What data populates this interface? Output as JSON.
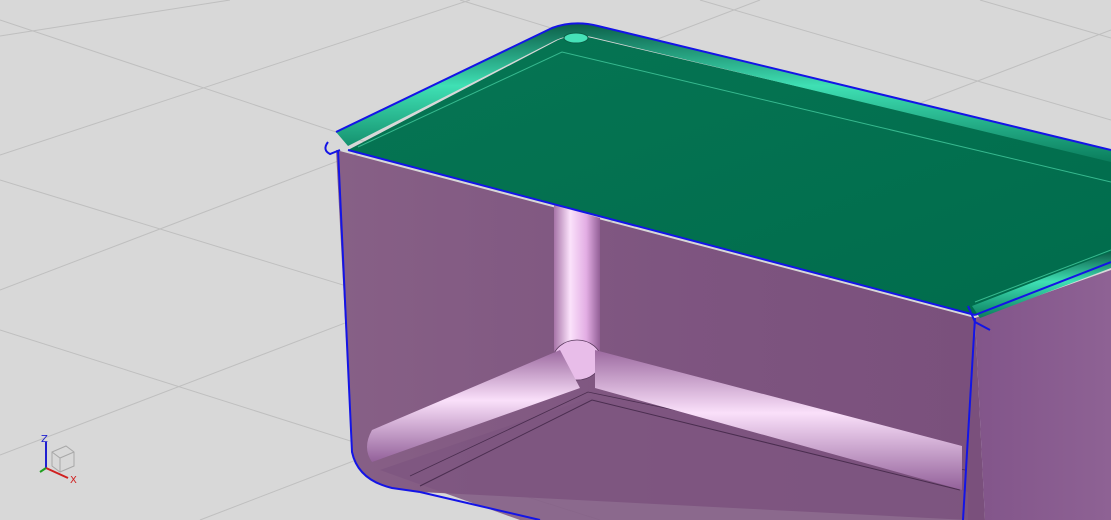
{
  "viewport": {
    "background_color": "#d8d8d8",
    "grid_color": "#bdbdbd"
  },
  "model": {
    "rim_color": "#0d7a5a",
    "lid_color": "#04704f",
    "wall_color": "#8a5d8c",
    "edge_color": "#1010e0",
    "highlight_color": "#f4c8f4"
  },
  "axis_triad": {
    "z_label": "Z",
    "x_label": "X",
    "z_color": "#2020d0",
    "x_color": "#d02020",
    "y_color": "#20a020"
  }
}
